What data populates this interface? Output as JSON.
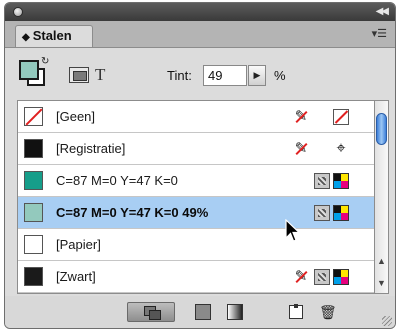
{
  "panel": {
    "tab_label": "Stalen",
    "tab_prefix": "◆"
  },
  "toolbar": {
    "format_text_glyph": "T",
    "tint_label": "Tint:",
    "tint_value": "49",
    "tint_unit": "%"
  },
  "swatches": [
    {
      "name": "[Geen]",
      "chip_color": "none",
      "icons": [
        "noedit-icon",
        "stroke-none-icon"
      ]
    },
    {
      "name": "[Registratie]",
      "chip_color": "#111111",
      "icons": [
        "noedit-icon",
        "registration-icon"
      ]
    },
    {
      "name": "C=87 M=0 Y=47 K=0",
      "chip_color": "#169e8a",
      "icons": [
        "process-color-icon",
        "cmyk-mode-icon"
      ]
    },
    {
      "name": "C=87 M=0 Y=47 K=0 49%",
      "chip_color": "#93c9bd",
      "selected": true,
      "icons": [
        "process-color-icon",
        "cmyk-mode-icon"
      ]
    },
    {
      "name": "[Papier]",
      "chip_color": "#ffffff",
      "icons": []
    },
    {
      "name": "[Zwart]",
      "chip_color": "#1a1a1a",
      "icons": [
        "noedit-icon",
        "process-color-icon",
        "cmyk-mode-icon"
      ]
    }
  ],
  "colors": {
    "selection": "#a8cef3",
    "scroll_thumb": "#3d7fd9",
    "none_red": "#e02020"
  }
}
